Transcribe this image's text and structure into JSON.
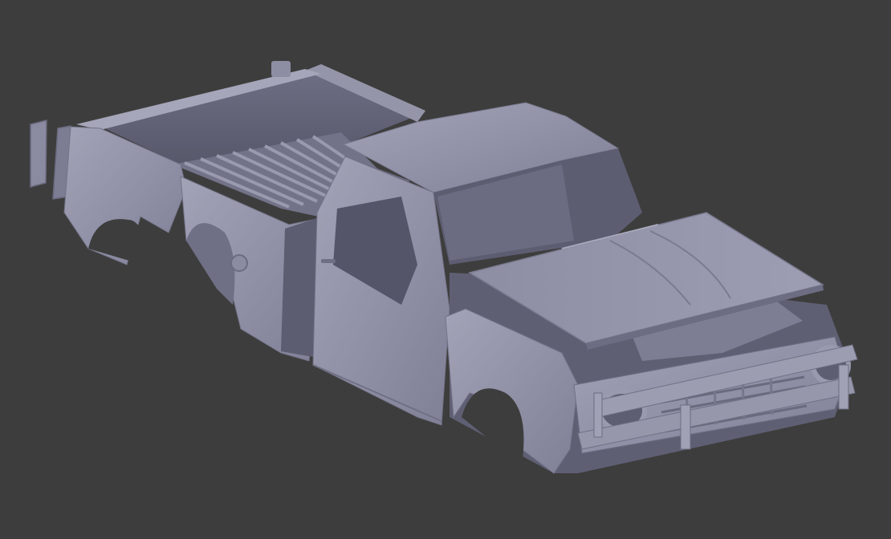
{
  "viewport": {
    "background": "#3d3d3d",
    "model_color": "#8f8fa6",
    "model_shadow": "#5e5e72",
    "model_highlight": "#a8a8bd"
  }
}
